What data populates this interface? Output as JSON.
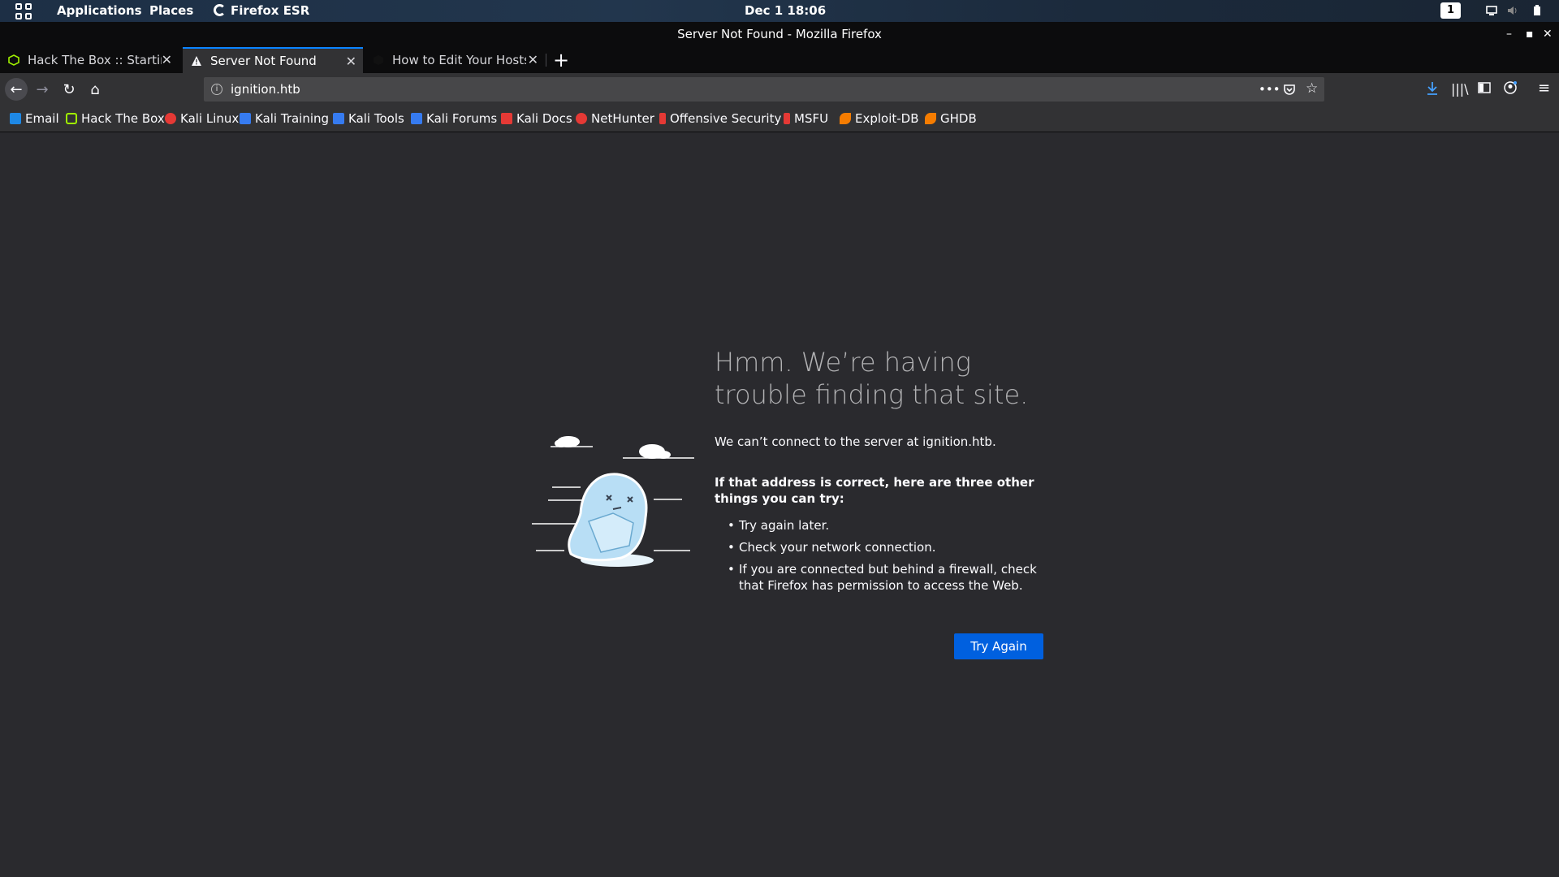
{
  "topbar": {
    "applications": "Applications",
    "places": "Places",
    "firefox": "Firefox ESR",
    "clock": "Dec 1  18:06",
    "workspace": "1"
  },
  "window": {
    "title": "Server Not Found - Mozilla Firefox"
  },
  "tabs": [
    {
      "title": "Hack The Box :: Starting P",
      "icon": "hackthebox-icon",
      "active": false
    },
    {
      "title": "Server Not Found",
      "icon": "warning-icon",
      "active": true
    },
    {
      "title": "How to Edit Your Hosts Fi",
      "icon": "hexagon-icon",
      "active": false
    }
  ],
  "navbar": {
    "url": "ignition.htb"
  },
  "bookmarks": [
    {
      "label": "Email",
      "icon": "email-icon",
      "color": "#1e88e5"
    },
    {
      "label": "Hack The Box",
      "icon": "hackthebox-icon",
      "color": "#9fef00"
    },
    {
      "label": "Kali Linux",
      "icon": "kali-icon",
      "color": "#e53935"
    },
    {
      "label": "Kali Training",
      "icon": "kali-training-icon",
      "color": "#367bf0"
    },
    {
      "label": "Kali Tools",
      "icon": "kali-tools-icon",
      "color": "#367bf0"
    },
    {
      "label": "Kali Forums",
      "icon": "kali-forums-icon",
      "color": "#367bf0"
    },
    {
      "label": "Kali Docs",
      "icon": "kali-docs-icon",
      "color": "#e53935"
    },
    {
      "label": "NetHunter",
      "icon": "nethunter-icon",
      "color": "#e53935"
    },
    {
      "label": "Offensive Security",
      "icon": "offsec-icon",
      "color": "#e53935"
    },
    {
      "label": "MSFU",
      "icon": "msfu-icon",
      "color": "#e53935"
    },
    {
      "label": "Exploit-DB",
      "icon": "exploitdb-icon",
      "color": "#f57c00"
    },
    {
      "label": "GHDB",
      "icon": "ghdb-icon",
      "color": "#f57c00"
    }
  ],
  "error": {
    "title": "Hmm. We’re having trouble finding that site.",
    "description": "We can’t connect to the server at ignition.htb.",
    "subtitle": "If that address is correct, here are three other things you can try:",
    "suggestions": [
      "Try again later.",
      "Check your network connection.",
      "If you are connected but behind a firewall, check that Firefox has permission to access the Web."
    ],
    "button": "Try Again"
  },
  "colors": {
    "accent": "#0a84ff",
    "button": "#0060df",
    "background": "#2a2a2e"
  }
}
